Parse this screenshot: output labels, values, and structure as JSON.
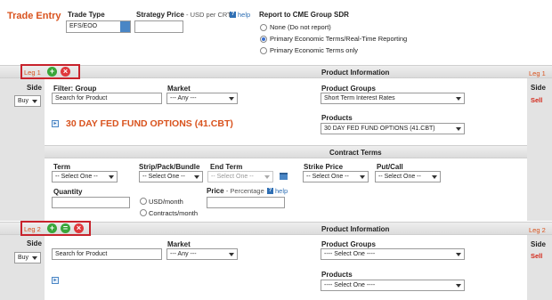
{
  "header": {
    "title": "Trade Entry",
    "trade_type_label": "Trade Type",
    "trade_type_value": "EFS/EOO",
    "strategy_price_label": "Strategy Price",
    "strategy_price_sub": "- USD per CRT",
    "help": "help",
    "report_title": "Report to CME Group SDR",
    "report_options": [
      "None (Do not report)",
      "Primary Economic Terms/Real-Time Reporting",
      "Primary Economic Terms only"
    ],
    "report_selected": 1
  },
  "leg1": {
    "tag": "Leg 1",
    "side_label": "Side",
    "side_value": "Buy",
    "right_tag": "Leg 1",
    "right_side_label": "Side",
    "right_side_value": "Sell",
    "product_info_title": "Product Information",
    "filter_label": "Filter: Group",
    "filter_value": "Search for Product",
    "market_label": "Market",
    "market_value": "--- Any ---",
    "product_groups_label": "Product Groups",
    "product_groups_value": "Short Term Interest Rates",
    "product_title": "30 DAY FED FUND OPTIONS (41.CBT)",
    "products_label": "Products",
    "products_value": "30 DAY FED FUND OPTIONS (41.CBT)",
    "contract_terms_title": "Contract Terms",
    "term_label": "Term",
    "term_value": "-- Select One --",
    "strip_label": "Strip/Pack/Bundle",
    "strip_value": "-- Select One --",
    "end_term_label": "End Term",
    "end_term_value": "-- Select One --",
    "strike_label": "Strike Price",
    "strike_value": "-- Select One --",
    "putcall_label": "Put/Call",
    "putcall_value": "-- Select One --",
    "quantity_label": "Quantity",
    "unit_options": [
      "USD/month",
      "Contracts/month"
    ],
    "price_label": "Price",
    "price_sub": "- Percentage",
    "help": "help"
  },
  "leg2": {
    "tag": "Leg 2",
    "side_label": "Side",
    "side_value": "Buy",
    "right_tag": "Leg 2",
    "right_side_label": "Side",
    "right_side_value": "Sell",
    "product_info_title": "Product Information",
    "search_value": "Search for Product",
    "market_label": "Market",
    "market_value": "--- Any ---",
    "product_groups_label": "Product Groups",
    "product_groups_value": "---- Select One ----",
    "products_label": "Products",
    "products_value": "---- Select One ----"
  },
  "colors": {
    "title_orange": "#d9531e",
    "leg_box_red": "#c8232c",
    "add_green": "#3aa63a",
    "remove_red": "#e0383c",
    "help_blue": "#2f6fb4",
    "sell_red": "#d32a1c"
  },
  "icons": [
    "add-icon",
    "remove-icon",
    "copy-icon",
    "help-icon",
    "expand-icon",
    "calendar-icon",
    "dropdown-arrow-icon"
  ]
}
